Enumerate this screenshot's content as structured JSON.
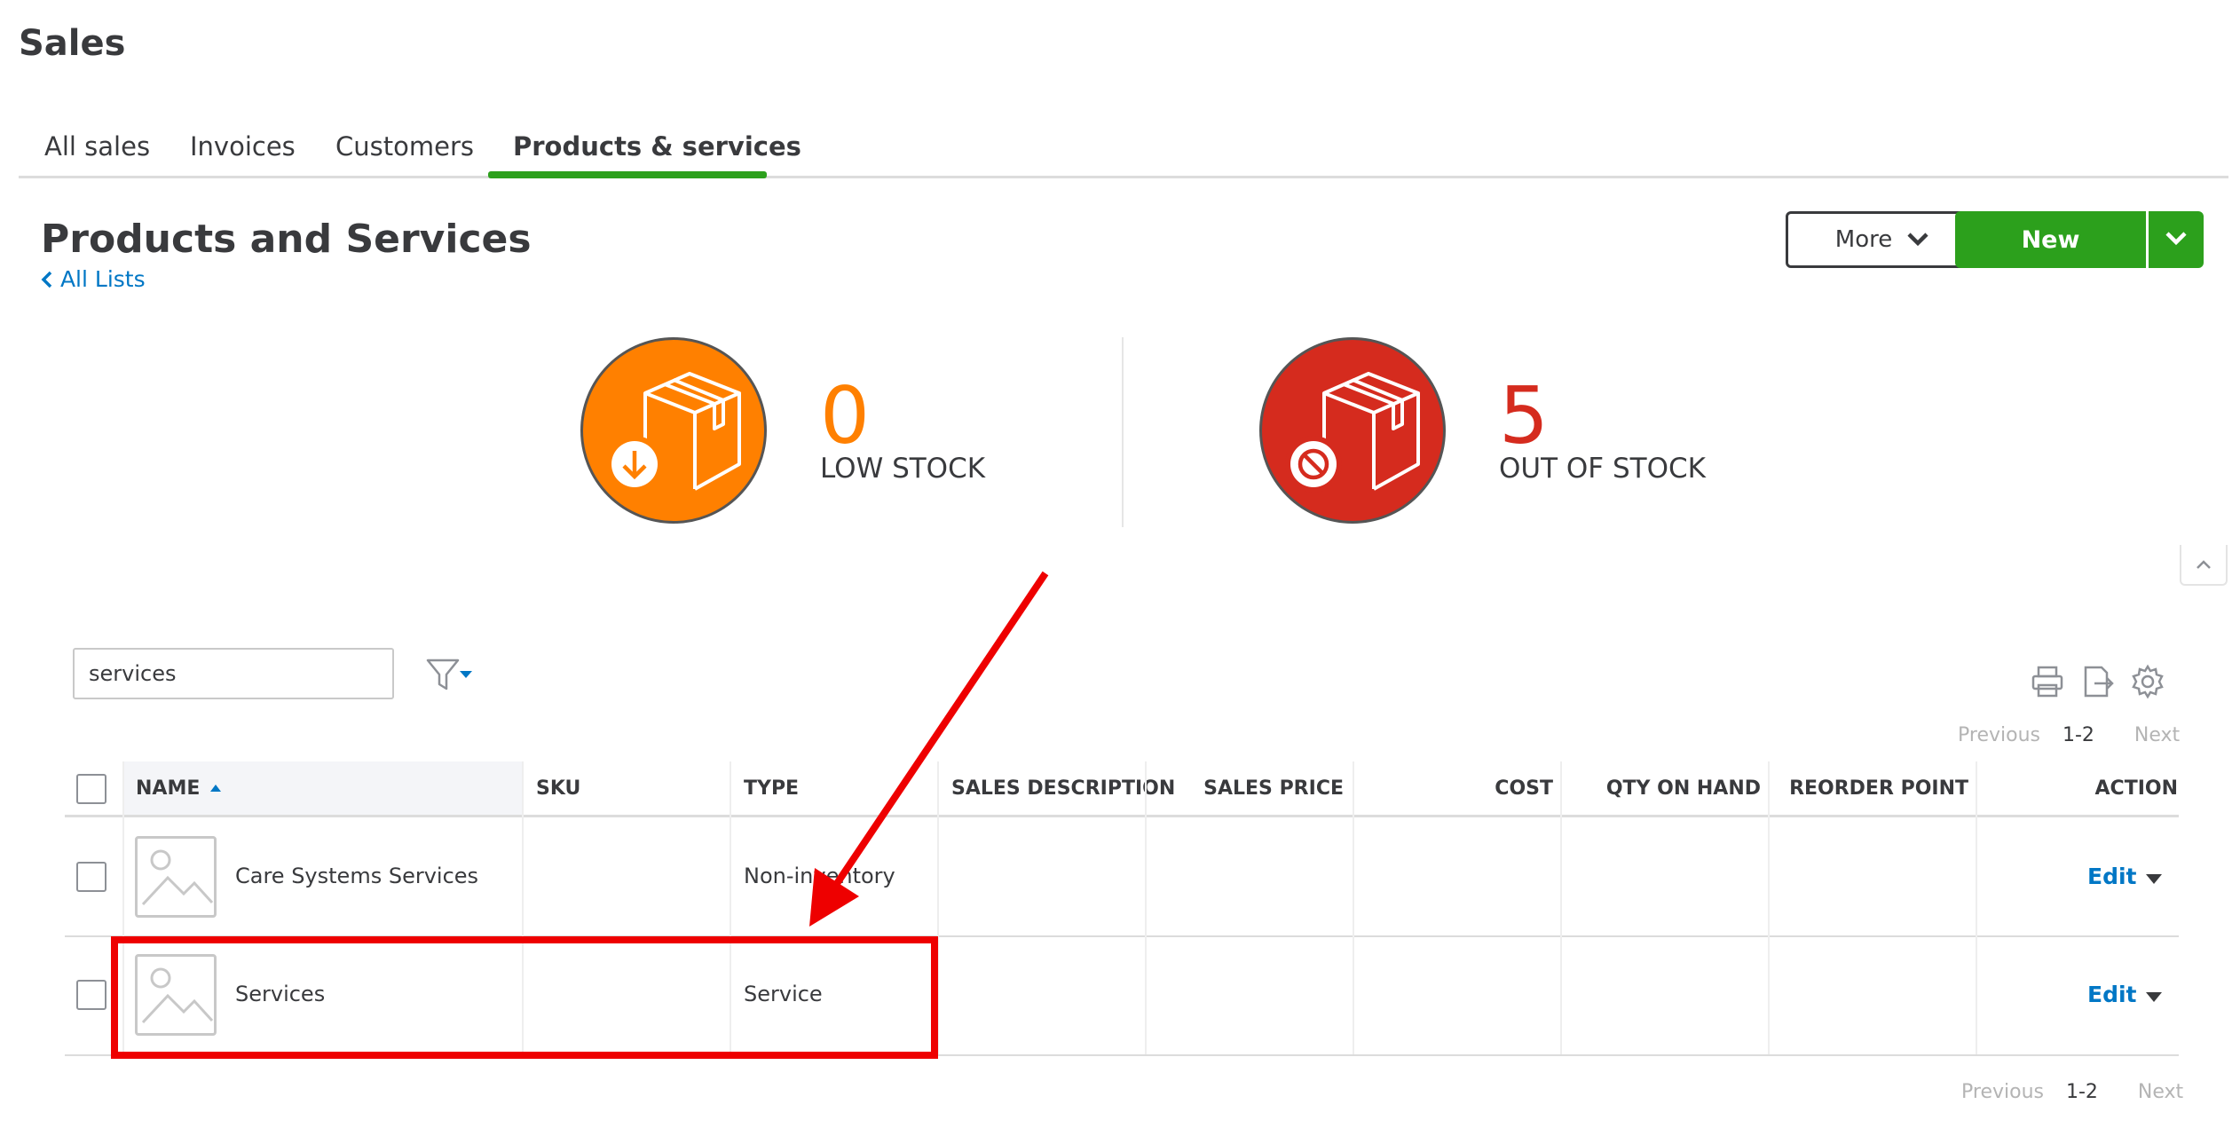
{
  "header": {
    "title": "Sales"
  },
  "tabs": [
    {
      "label": "All sales",
      "active": false
    },
    {
      "label": "Invoices",
      "active": false
    },
    {
      "label": "Customers",
      "active": false
    },
    {
      "label": "Products & services",
      "active": true
    }
  ],
  "section": {
    "title": "Products and Services",
    "back_link": "All Lists"
  },
  "toolbar": {
    "more_label": "More",
    "new_label": "New"
  },
  "stock": {
    "low": {
      "count": "0",
      "label": "LOW STOCK",
      "color": "#ff8000"
    },
    "out": {
      "count": "5",
      "label": "OUT OF STOCK",
      "color": "#d52b1e"
    }
  },
  "search": {
    "value": "services"
  },
  "pagination": {
    "previous": "Previous",
    "range": "1-2",
    "next": "Next"
  },
  "table": {
    "columns": [
      "NAME",
      "SKU",
      "TYPE",
      "SALES DESCRIPTION",
      "SALES PRICE",
      "COST",
      "QTY ON HAND",
      "REORDER POINT",
      "ACTION"
    ],
    "rows": [
      {
        "name": "Care Systems Services",
        "sku": "",
        "type": "Non-inventory",
        "sales_description": "",
        "sales_price": "",
        "cost": "",
        "qty_on_hand": "",
        "reorder_point": "",
        "action": "Edit"
      },
      {
        "name": "Services",
        "sku": "",
        "type": "Service",
        "sales_description": "",
        "sales_price": "",
        "cost": "",
        "qty_on_hand": "",
        "reorder_point": "",
        "action": "Edit"
      }
    ]
  },
  "colors": {
    "accent_green": "#2ca01c",
    "link_blue": "#0077c5",
    "annotation_red": "#ee0000"
  }
}
